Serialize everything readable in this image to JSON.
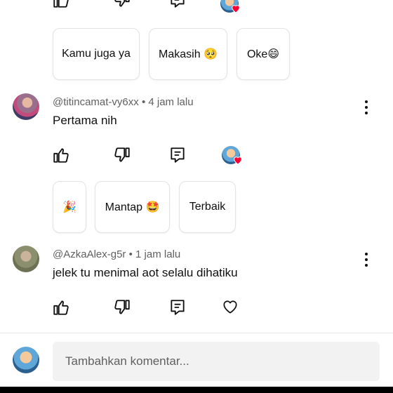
{
  "top_actions": {
    "like": "like-icon",
    "dislike": "dislike-icon",
    "reply": "reply-icon"
  },
  "top_chips": [
    "Kamu juga ya",
    "Makasih 🥺",
    "Oke😄"
  ],
  "comments": [
    {
      "handle": "@titincamat-vy6xx",
      "time": "4 jam lalu",
      "separator": "•",
      "text": "Pertama nih",
      "chips": [
        "🎉",
        "Mantap 🤩",
        "Terbaik"
      ]
    },
    {
      "handle": "@AzkaAlex-g5r",
      "time": "1 jam lalu",
      "separator": "•",
      "text": "jelek tu menimal aot selalu dihatiku"
    }
  ],
  "composer": {
    "placeholder": "Tambahkan komentar..."
  },
  "colors": {
    "heart": "#ff0033",
    "chip_border": "#e3e3e3",
    "composer_bg": "#f2f2f2"
  }
}
